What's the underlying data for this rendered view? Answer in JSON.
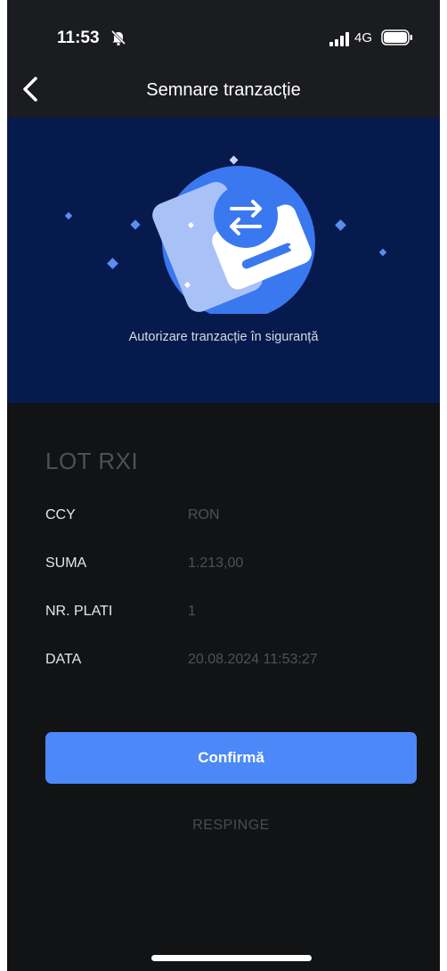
{
  "status_bar": {
    "time": "11:53",
    "network": "4G",
    "icons": [
      "bell-slash-icon",
      "signal-bars-icon",
      "battery-icon"
    ]
  },
  "nav": {
    "title": "Semnare tranzacție",
    "back_icon": "chevron-left-icon"
  },
  "hero": {
    "caption": "Autorizare tranzacție în siguranță",
    "illustration": "phone-transfer-icon"
  },
  "details": {
    "title": "LOT RXI",
    "rows": [
      {
        "label": "CCY",
        "value": "RON"
      },
      {
        "label": "SUMA",
        "value": "1.213,00"
      },
      {
        "label": "NR. PLATI",
        "value": "1"
      },
      {
        "label": "DATA",
        "value": "20.08.2024 11:53:27"
      }
    ]
  },
  "actions": {
    "confirm_label": "Confirmă",
    "reject_label": "RESPINGE"
  },
  "colors": {
    "background": "#121315",
    "hero_background": "#071a4d",
    "accent": "#4c88f7",
    "muted_text": "#4d5158"
  }
}
